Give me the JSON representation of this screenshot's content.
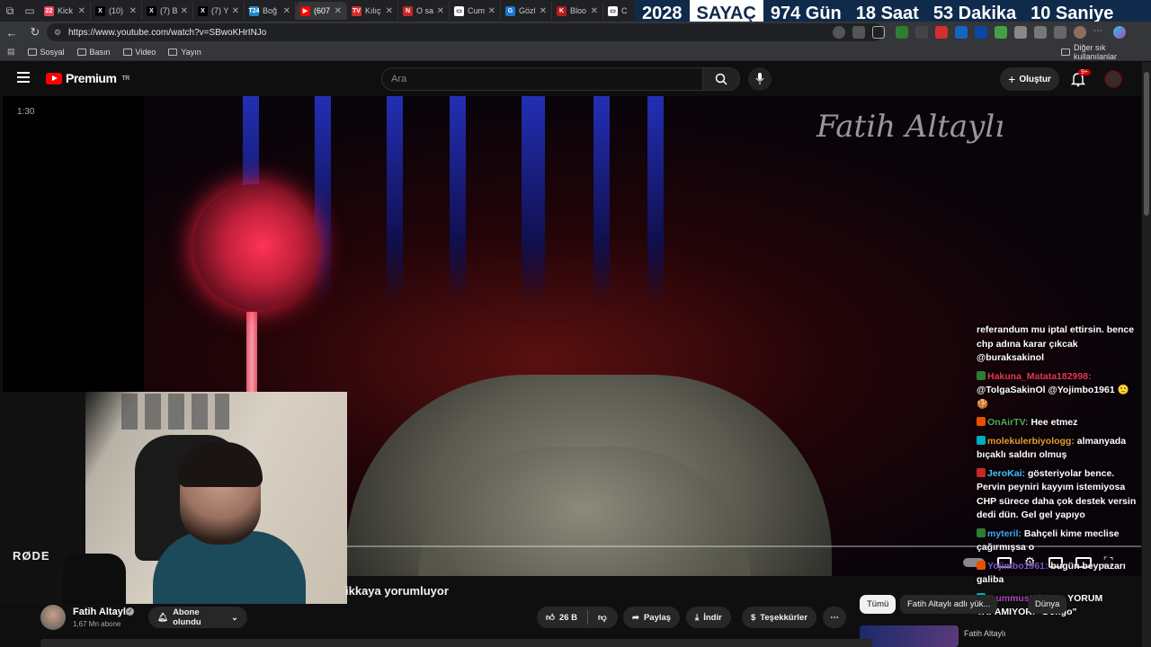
{
  "browser": {
    "tabs": [
      {
        "label": "Kick",
        "color": "#e94560",
        "glyph": "22"
      },
      {
        "label": "(10)",
        "color": "#000000",
        "glyph": "X"
      },
      {
        "label": "(7) B",
        "color": "#000000",
        "glyph": "X"
      },
      {
        "label": "(7) Y",
        "color": "#000000",
        "glyph": "X"
      },
      {
        "label": "Boğ",
        "color": "#1e88c8",
        "glyph": "T24"
      },
      {
        "label": "(607",
        "color": "#ff0000",
        "glyph": "▶"
      },
      {
        "label": "Kılıç",
        "color": "#d32f2f",
        "glyph": "TV"
      },
      {
        "label": "O sa",
        "color": "#c62828",
        "glyph": "N"
      },
      {
        "label": "Cum",
        "color": "#ffffff",
        "glyph": "▭"
      },
      {
        "label": "Gözl",
        "color": "#1976d2",
        "glyph": "G"
      },
      {
        "label": "Bloo",
        "color": "#b71c1c",
        "glyph": "K"
      },
      {
        "label": "C",
        "color": "#ffffff",
        "glyph": "▭"
      }
    ],
    "url": "https://www.youtube.com/watch?v=SBwoKHrINJo",
    "bookmarks": [
      "Sosyal",
      "Basın",
      "Video",
      "Yayın"
    ],
    "other_bookmarks": "Diğer sık kullanılanlar"
  },
  "countdown": {
    "year": "2028",
    "tag": "SAYAÇ",
    "days": "974 Gün",
    "hours": "18 Saat",
    "minutes": "53 Dakika",
    "seconds": "10 Saniye"
  },
  "youtube": {
    "logo_text": "Premium",
    "logo_region": "TR",
    "search_placeholder": "Ara",
    "create_label": "Oluştur",
    "notification_badge": "9+"
  },
  "video": {
    "timecode": "1:30",
    "watermark": "Fatih Altaylı",
    "title_visible": "ikkaya yorumluyor",
    "webcam_mic_brand": "RØDE"
  },
  "chat": [
    {
      "user": "",
      "user_color": "#ffffff",
      "text": "referandum mu iptal ettirsin. bence chp adına karar çıkcak @buraksakinol"
    },
    {
      "user": "Hakuna_Matata182998:",
      "user_color": "#e53950",
      "text": "@TolgaSakinOl @Yojimbo1961 🙂 🍪"
    },
    {
      "user": "OnAirTV:",
      "user_color": "#4caf50",
      "text": "Hee etmez"
    },
    {
      "user": "molekulerbiyologg:",
      "user_color": "#e0a030",
      "text": "almanyada bıçaklı saldırı olmuş"
    },
    {
      "user": "JeroKai:",
      "user_color": "#40c4ff",
      "text": "gösteriyolar bence. Pervin peyniri kayyım istemiyosa CHP sürece daha çok destek versin dedi dün. Gel gel yapıyo"
    },
    {
      "user": "myteril:",
      "user_color": "#42a5f5",
      "text": "Bahçeli kime meclise çağırmışsa o"
    },
    {
      "user": "Yojimbo1961:",
      "user_color": "#7e57c2",
      "text": "bugün beypazarı galiba"
    },
    {
      "user": "mummustafa123:",
      "user_color": "#ab47bc",
      "text": "YORUM YAPAMIYOR: \"Dongo\""
    }
  ],
  "channel": {
    "name": "Fatih Altaylı",
    "subscribers": "1,67 Mn abone",
    "subscribe_label": "Abone olundu"
  },
  "actions": {
    "likes": "26 B",
    "share": "Paylaş",
    "download": "İndir",
    "thanks": "Teşekkürler"
  },
  "chips": [
    "Tümü",
    "Fatih Altaylı adlı yük...",
    "Dünya"
  ],
  "recommended": {
    "channel": "Fatih Altaylı"
  }
}
